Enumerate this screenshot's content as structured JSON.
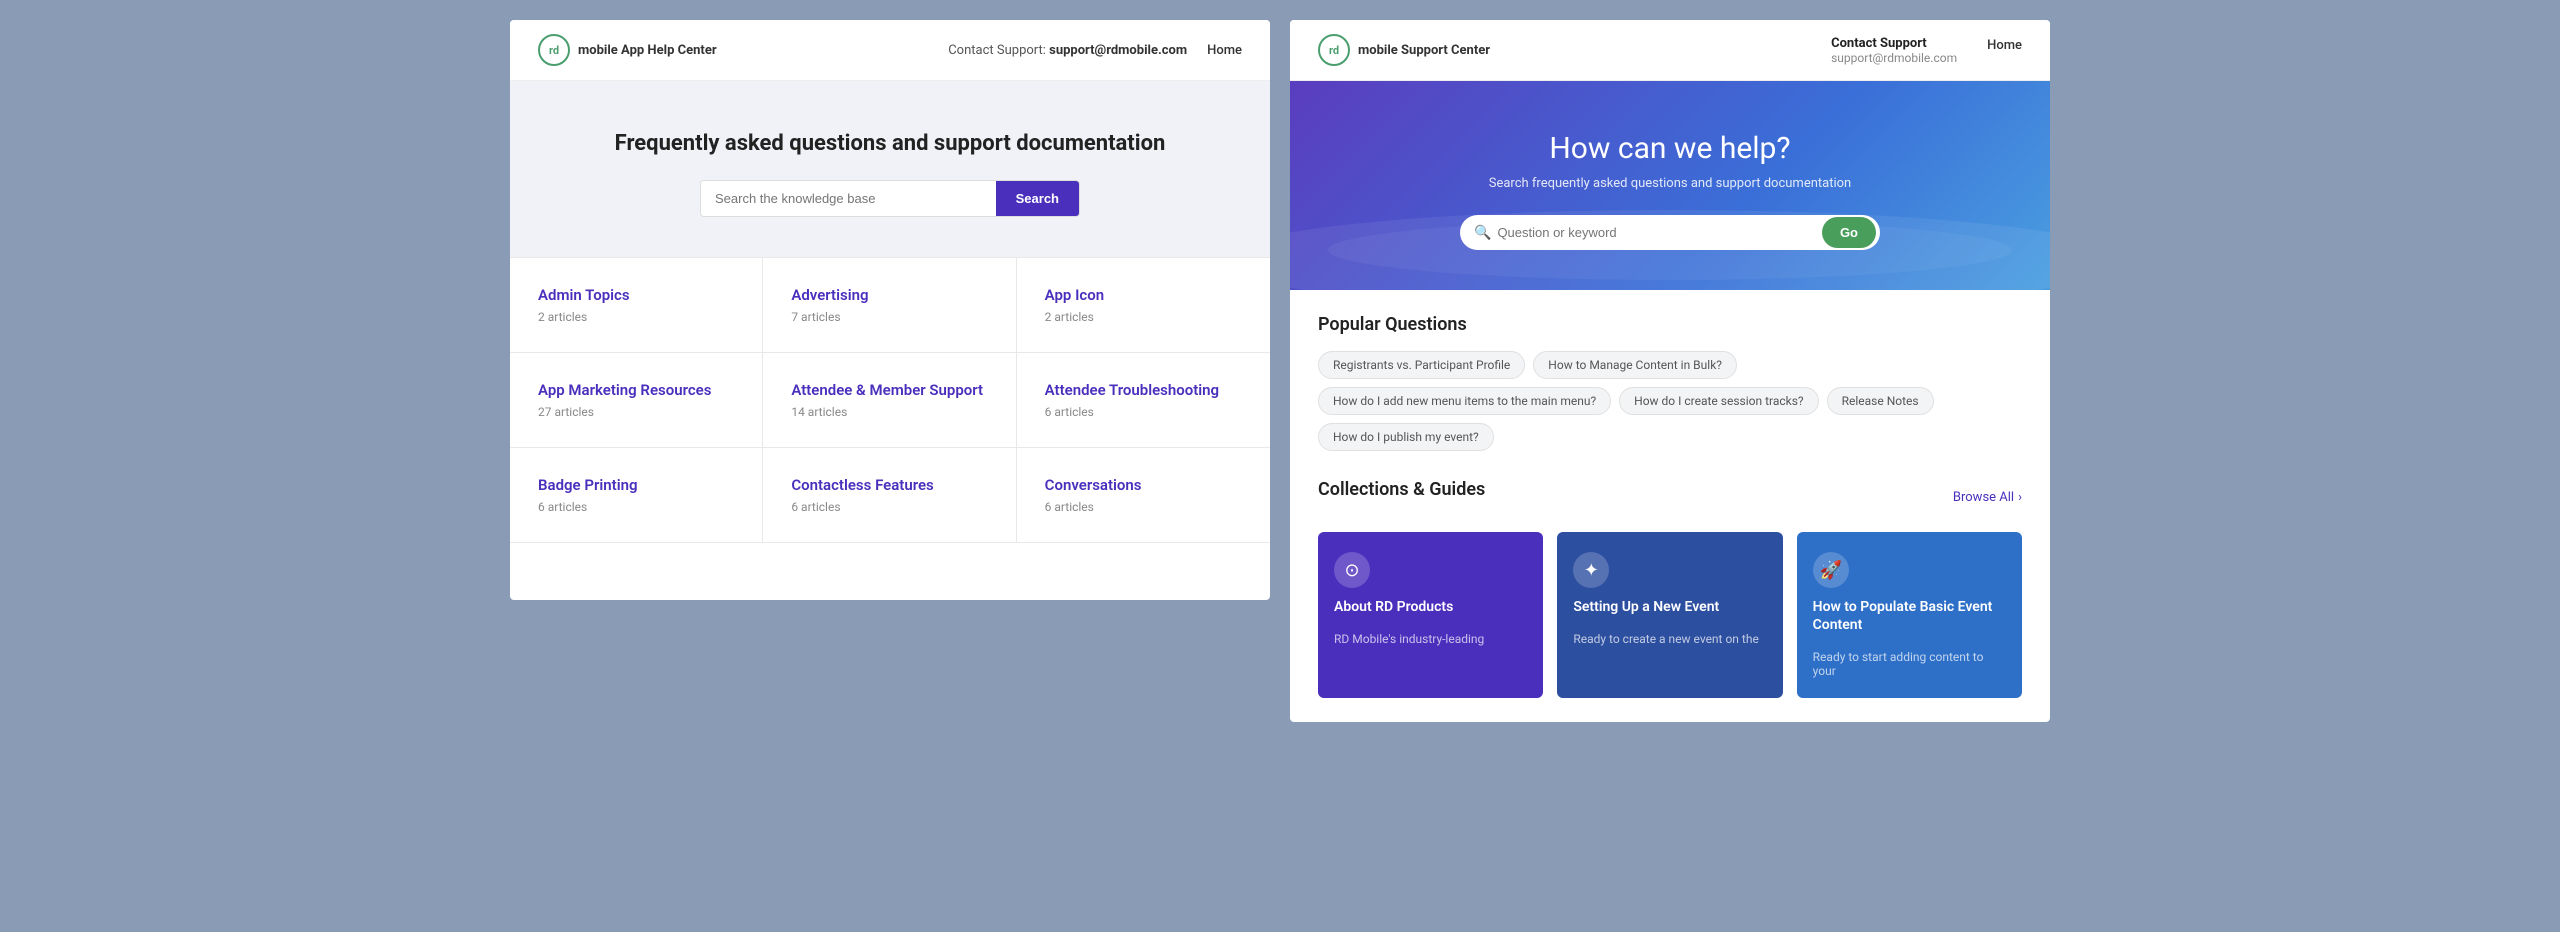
{
  "left": {
    "logo": {
      "initials": "rd",
      "brand": "mobile",
      "subtitle": "App Help Center"
    },
    "nav": {
      "contact_label": "Contact Support:",
      "contact_email": "support@rdmobile.com",
      "home": "Home"
    },
    "hero": {
      "title": "Frequently asked questions and support documentation",
      "search_placeholder": "Search the knowledge base",
      "search_button": "Search"
    },
    "categories": [
      {
        "name": "Admin Topics",
        "count": "2 articles"
      },
      {
        "name": "Advertising",
        "count": "7 articles"
      },
      {
        "name": "App Icon",
        "count": "2 articles"
      },
      {
        "name": "App Marketing Resources",
        "count": "27 articles"
      },
      {
        "name": "Attendee & Member Support",
        "count": "14 articles"
      },
      {
        "name": "Attendee Troubleshooting",
        "count": "6 articles"
      },
      {
        "name": "Badge Printing",
        "count": "6 articles"
      },
      {
        "name": "Contactless Features",
        "count": "6 articles"
      },
      {
        "name": "Conversations",
        "count": "6 articles"
      }
    ]
  },
  "right": {
    "logo": {
      "initials": "rd",
      "brand": "mobile",
      "subtitle": "Support Center"
    },
    "nav": {
      "contact_label": "Contact Support",
      "contact_email": "support@rdmobile.com",
      "home": "Home"
    },
    "hero": {
      "title": "How can we help?",
      "subtitle": "Search frequently asked questions and support documentation",
      "search_placeholder": "Question or keyword",
      "search_button": "Go"
    },
    "popular": {
      "title": "Popular Questions",
      "tags": [
        "Registrants vs. Participant Profile",
        "How to Manage Content in Bulk?",
        "How do I add new menu items to the main menu?",
        "How do I create session tracks?",
        "Release Notes",
        "How do I publish my event?"
      ]
    },
    "collections": {
      "title": "Collections & Guides",
      "browse_all": "Browse All",
      "cards": [
        {
          "icon": "⊙",
          "title": "About RD Products",
          "description": "RD Mobile's industry-leading",
          "color": "card-purple"
        },
        {
          "icon": "✦",
          "title": "Setting Up a New Event",
          "description": "Ready to create a new event on the",
          "color": "card-darkblue"
        },
        {
          "icon": "🚀",
          "title": "How to Populate Basic Event Content",
          "description": "Ready to start adding content to your",
          "color": "card-blue"
        }
      ]
    }
  }
}
